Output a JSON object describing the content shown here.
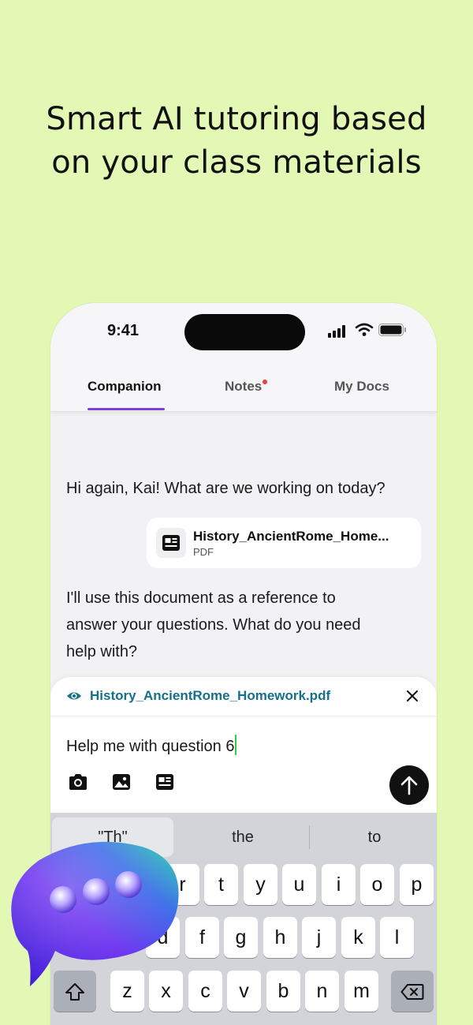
{
  "headline": {
    "line1": "Smart AI tutoring based",
    "line2": "on your class materials"
  },
  "status_bar": {
    "time": "9:41"
  },
  "tabs": [
    {
      "label": "Companion",
      "active": true
    },
    {
      "label": "Notes",
      "has_notification_dot": true
    },
    {
      "label": "My Docs"
    }
  ],
  "chat": {
    "greeting": "Hi again, Kai! What are we working on today?",
    "document": {
      "title": "History_AncientRome_Home...",
      "type": "PDF"
    },
    "reply_line1": "I'll use this document as a reference to",
    "reply_line2": "answer your questions. What do you need",
    "reply_line3": "help with?"
  },
  "composer": {
    "attachment_name": "History_AncientRome_Homework.pdf",
    "input_value": "Help me with question 6",
    "tools": [
      "camera-icon",
      "image-icon",
      "document-icon"
    ],
    "send_icon": "arrow-up-icon"
  },
  "keyboard": {
    "suggestions": [
      "\"Th\"",
      "the",
      "to"
    ],
    "row1": [
      "r",
      "t",
      "y",
      "u",
      "i",
      "o",
      "p"
    ],
    "row2": [
      "d",
      "f",
      "g",
      "h",
      "j",
      "k",
      "l"
    ],
    "row3": [
      "z",
      "x",
      "c",
      "v",
      "b",
      "n",
      "m"
    ],
    "shift_icon": "shift-icon",
    "delete_icon": "backspace-icon"
  },
  "colors": {
    "background": "#e3f8b5",
    "tab_accent": "#7b3fe4",
    "attachment_text": "#15708a",
    "notification_dot": "#e5433b",
    "cursor": "#2ecc40"
  }
}
